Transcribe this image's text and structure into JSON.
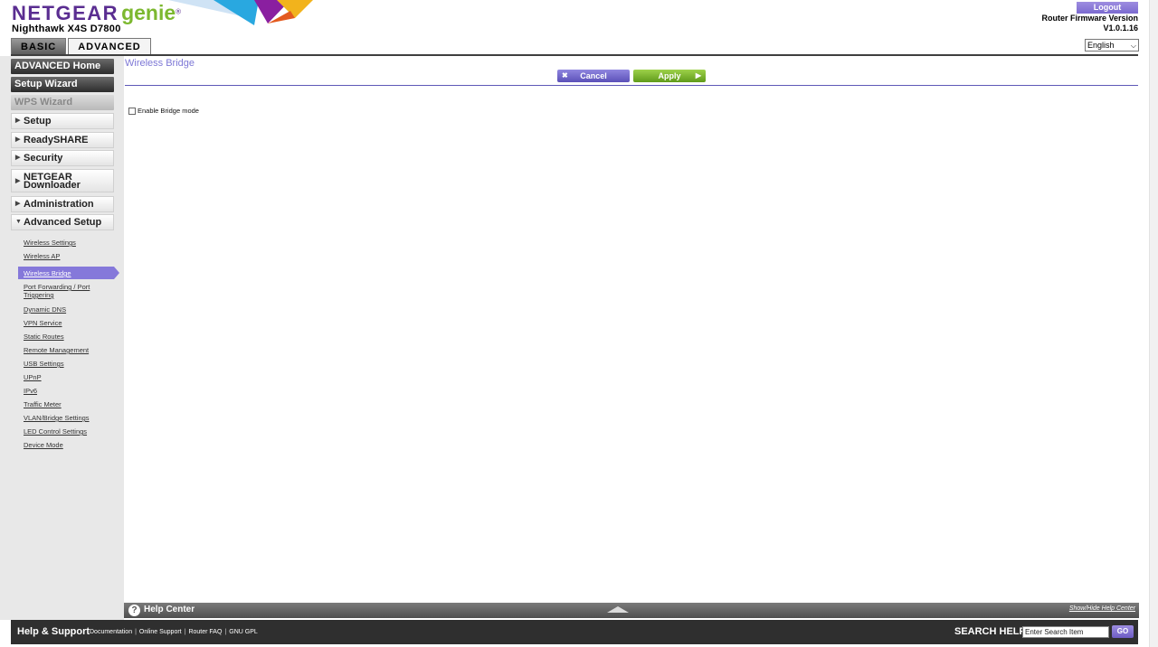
{
  "header": {
    "brand": "NETGEAR",
    "brand_product": "genie",
    "registered_mark": "®",
    "model": "Nighthawk X4S D7800",
    "tabs": [
      {
        "label": "BASIC",
        "active": false
      },
      {
        "label": "ADVANCED",
        "active": true
      }
    ],
    "logout_label": "Logout",
    "firmware_label": "Router Firmware Version",
    "firmware_version": "V1.0.1.16",
    "language": "English"
  },
  "sidebar": {
    "main_buttons": [
      {
        "label": "ADVANCED Home"
      },
      {
        "label": "Setup Wizard"
      },
      {
        "label": "WPS Wizard"
      }
    ],
    "menu": [
      {
        "label": "Setup",
        "expanded": false
      },
      {
        "label": "ReadySHARE",
        "expanded": false
      },
      {
        "label": "Security",
        "expanded": false
      },
      {
        "label": "NETGEAR Downloader",
        "expanded": false
      },
      {
        "label": "Administration",
        "expanded": false
      },
      {
        "label": "Advanced Setup",
        "expanded": true
      }
    ],
    "submenu": [
      {
        "label": "Wireless Settings"
      },
      {
        "label": "Wireless AP"
      },
      {
        "label": "Wireless Bridge",
        "active": true
      },
      {
        "label": "Port Forwarding / Port Triggering"
      },
      {
        "label": "Dynamic DNS"
      },
      {
        "label": "VPN Service"
      },
      {
        "label": "Static Routes"
      },
      {
        "label": "Remote Management"
      },
      {
        "label": "USB Settings"
      },
      {
        "label": "UPnP"
      },
      {
        "label": "IPv6"
      },
      {
        "label": "Traffic Meter"
      },
      {
        "label": "VLAN/Bridge Settings"
      },
      {
        "label": "LED Control Settings"
      },
      {
        "label": "Device Mode"
      }
    ]
  },
  "main": {
    "title": "Wireless Bridge",
    "cancel_label": "Cancel",
    "apply_label": "Apply",
    "bridge_mode_label": "Enable Bridge mode",
    "bridge_mode_checked": false
  },
  "help_center": {
    "label": "Help Center",
    "help_icon": "?",
    "toggle_label": "Show/Hide Help Center"
  },
  "footer": {
    "title": "Help & Support",
    "links": [
      "Documentation",
      "Online Support",
      "Router FAQ",
      "GNU GPL"
    ],
    "search_label": "SEARCH HELP",
    "search_placeholder": "Enter Search Item",
    "go_label": "GO"
  },
  "colors": {
    "accent_purple": "#8578da",
    "apply_green": "#7cb82f",
    "sidebar_dark": "#3a3a3a",
    "footer_bg": "#2f2f2f"
  }
}
